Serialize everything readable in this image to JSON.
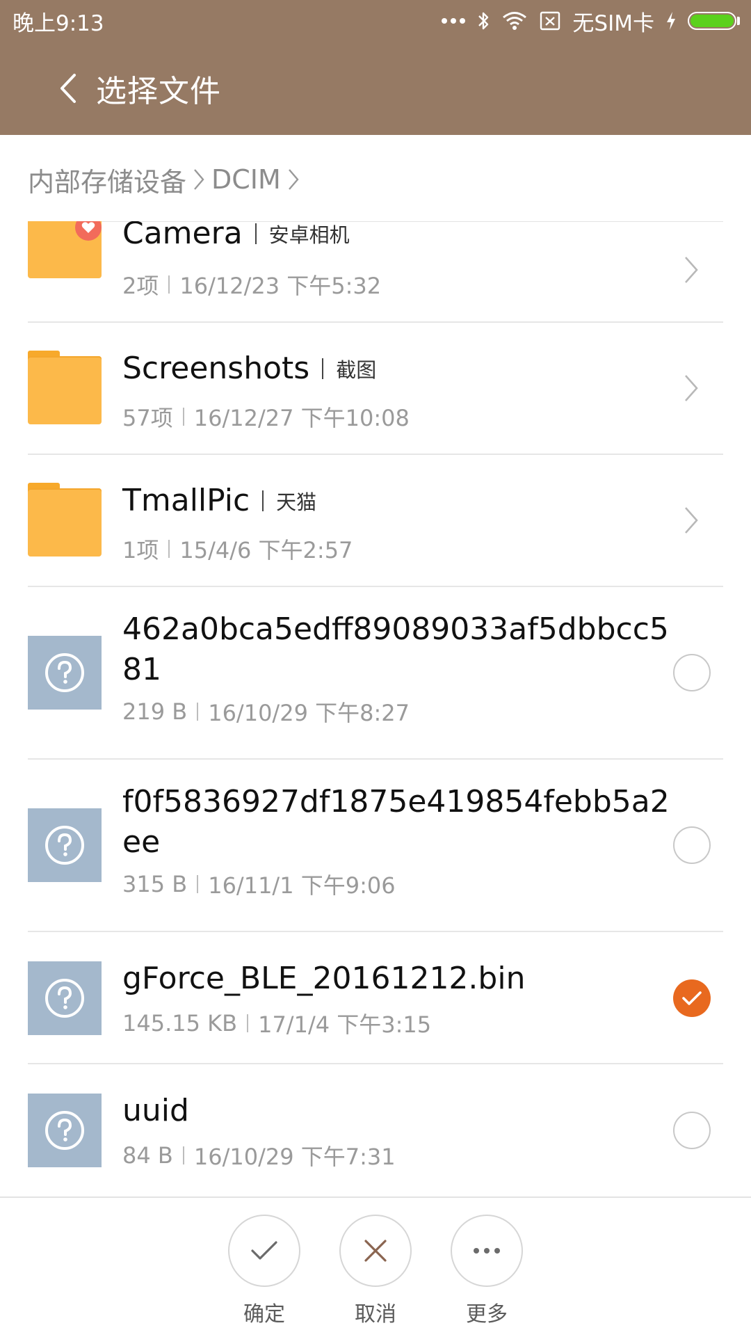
{
  "status_bar": {
    "time": "晚上9:13",
    "carrier": "无SIM卡"
  },
  "header": {
    "title": "选择文件"
  },
  "breadcrumb": {
    "items": [
      "内部存储设备",
      "DCIM"
    ]
  },
  "folders": [
    {
      "name": "Camera",
      "alias": "安卓相机",
      "count": "2项",
      "date": "16/12/23 下午5:32",
      "favorite": true
    },
    {
      "name": "Screenshots",
      "alias": "截图",
      "count": "57项",
      "date": "16/12/27 下午10:08",
      "favorite": false
    },
    {
      "name": "TmallPic",
      "alias": "天猫",
      "count": "1项",
      "date": "15/4/6 下午2:57",
      "favorite": false
    }
  ],
  "files": [
    {
      "name": "462a0bca5edff89089033af5dbbcc581",
      "size": "219 B",
      "date": "16/10/29 下午8:27",
      "selected": false
    },
    {
      "name": "f0f5836927df1875e419854febb5a2ee",
      "size": "315 B",
      "date": "16/11/1 下午9:06",
      "selected": false
    },
    {
      "name": "gForce_BLE_20161212.bin",
      "size": "145.15 KB",
      "date": "17/1/4 下午3:15",
      "selected": true
    },
    {
      "name": "uuid",
      "size": "84 B",
      "date": "16/10/29 下午7:31",
      "selected": false
    }
  ],
  "actions": {
    "confirm": "确定",
    "cancel": "取消",
    "more": "更多"
  },
  "colors": {
    "header": "#967a64",
    "accent": "#e8691f",
    "folder": "#fcb94a",
    "file_icon": "#a4b8cc"
  }
}
